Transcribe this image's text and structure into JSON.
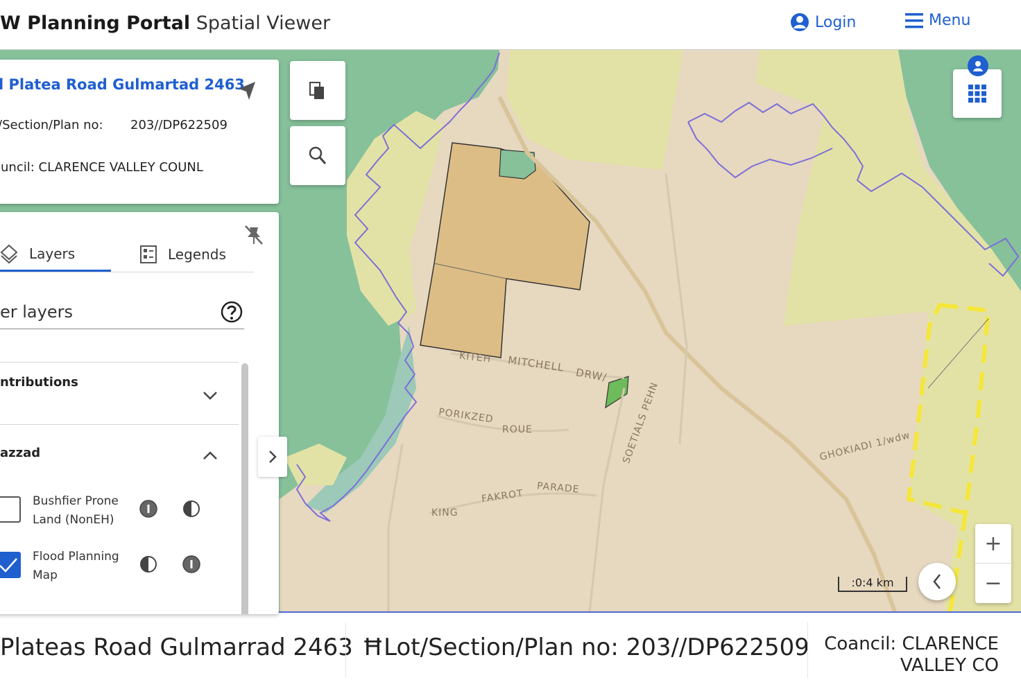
{
  "header": {
    "brand_bold": "W Planning Portal",
    "brand_thin": "Spatial Viewer",
    "login_label": "Login",
    "menu_label": "Menu"
  },
  "info_card": {
    "address": "’l Platea Road Gulmartad 2463",
    "lot_label": "t/Section/Plan no:",
    "lot_value": "203//DP622509",
    "council_label": "ouncil: CLARENCE VALLEY COUNL"
  },
  "panel": {
    "tab_layers": "Layers",
    "tab_legends": "Legends",
    "filter_label": "er layers",
    "sections": [
      {
        "title": "ntributions",
        "expanded": false
      },
      {
        "title": "azzad",
        "expanded": true
      }
    ],
    "items": [
      {
        "label": "Bushfier Prone Land (NonEH)",
        "checked": false
      },
      {
        "label": "Flood Planning Map",
        "checked": true
      }
    ]
  },
  "map": {
    "scale_label": ":0:4 km",
    "zoom_in": "+",
    "zoom_out": "−",
    "street_labels": [
      "KITEH",
      "MITCHELL",
      "DRW/",
      "PORIKZED",
      "ROUE",
      "PARADE",
      "FAKROT",
      "KING",
      "GHOKIADI 1/wdw",
      "SOETIALS PEHN"
    ],
    "colors": {
      "residential": "#e7d8c0",
      "green_zone": "#86c19a",
      "yellow_zone": "#e3e2a6",
      "parcel_orange": "#ddbd86",
      "boundary": "#7c6fd8",
      "selection": "#f5e63a"
    }
  },
  "footer": {
    "address": "Plateas Road Gulmarrad 2463",
    "lot": "ĦLot/Section/Plan no: 203//DP622509",
    "council_line1": "Coancil: CLARENCE",
    "council_line2": "VALLEY CO"
  }
}
